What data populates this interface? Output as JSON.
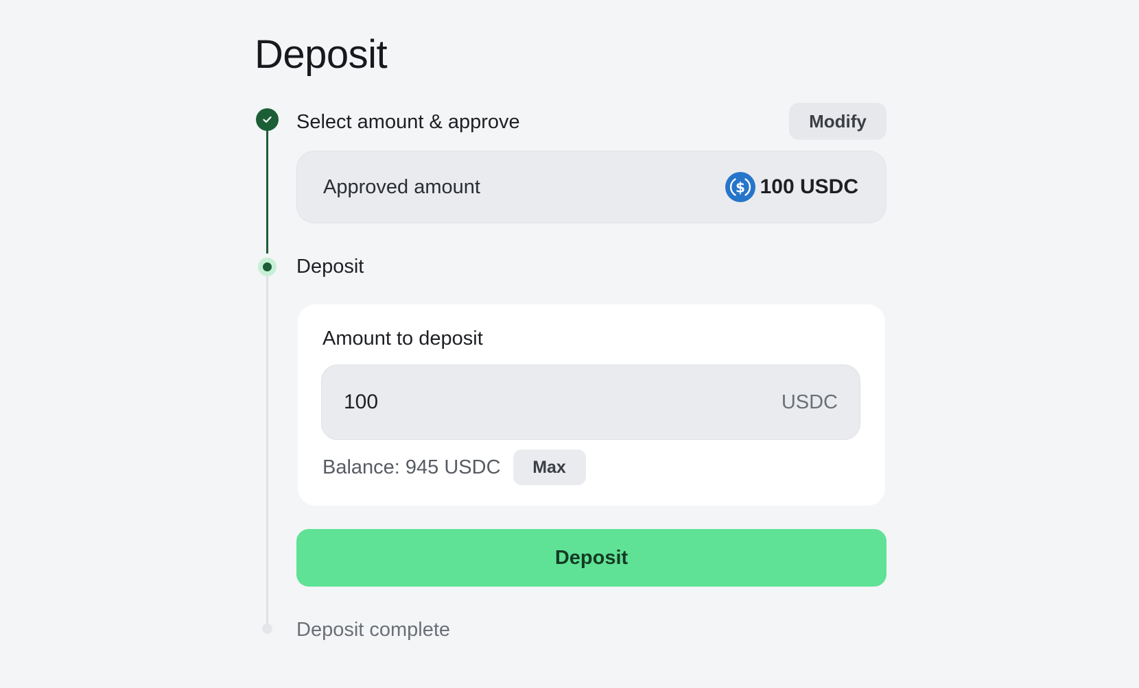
{
  "page": {
    "title": "Deposit"
  },
  "steps": [
    {
      "label": "Select amount & approve",
      "status": "complete"
    },
    {
      "label": "Deposit",
      "status": "active"
    },
    {
      "label": "Deposit complete",
      "status": "pending"
    }
  ],
  "approval": {
    "modify_label": "Modify",
    "approved_label": "Approved amount",
    "approved_value": "100 USDC",
    "token_icon": "usdc-coin-icon"
  },
  "deposit_form": {
    "amount_label": "Amount to deposit",
    "amount_value": "100",
    "unit": "USDC",
    "balance_text": "Balance: 945 USDC",
    "max_label": "Max"
  },
  "actions": {
    "deposit_label": "Deposit"
  },
  "colors": {
    "accent_green": "#5fe295",
    "step_done": "#1c5e36",
    "usdc_blue": "#2775ca"
  }
}
